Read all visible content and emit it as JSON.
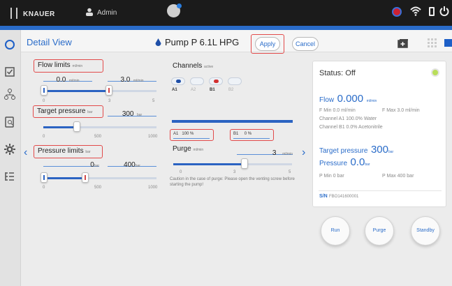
{
  "top": {
    "brand": "KNAUER",
    "user": "Admin"
  },
  "header": {
    "title": "Detail View",
    "pump": "Pump P 6.1L HPG",
    "apply": "Apply",
    "cancel": "Cancel"
  },
  "flow_limits": {
    "label": "Flow limits",
    "unit": "ml/min",
    "min": "0.0",
    "max": "3.0",
    "min_unit": "ml/min",
    "max_unit": "ml/min",
    "scale": [
      "0",
      "3",
      "5"
    ]
  },
  "target_pressure": {
    "label": "Target pressure",
    "unit": "bar",
    "value": "300",
    "value_unit": "bar",
    "scale": [
      "0",
      "500",
      "1000"
    ]
  },
  "pressure_limits": {
    "label": "Pressure limits",
    "unit": "bar",
    "min": "0",
    "max": "400",
    "min_unit": "bar",
    "max_unit": "bar",
    "scale": [
      "0",
      "500",
      "1000"
    ]
  },
  "channels": {
    "label": "Channels",
    "sub": "active",
    "items": [
      {
        "name": "A1",
        "active": true,
        "color": "#1f4fa8"
      },
      {
        "name": "A2",
        "active": false,
        "color": ""
      },
      {
        "name": "B1",
        "active": true,
        "color": "#d23030"
      },
      {
        "name": "B2",
        "active": false,
        "color": ""
      }
    ],
    "a1_label": "A1",
    "a1_value": "100",
    "a1_unit": "%",
    "b1_label": "B1",
    "b1_value": "0",
    "b1_unit": "%"
  },
  "purge": {
    "label": "Purge",
    "unit": "ml/min",
    "value": "3",
    "value_unit": "ml/min",
    "scale": [
      "0",
      "3",
      "5"
    ],
    "caution": "Caution in the case of purge: Please open the venting screw before starting the pump!"
  },
  "status": {
    "title": "Status: Off",
    "flow_label": "Flow",
    "flow_value": "0.000",
    "flow_unit": "ml/min",
    "fmin": "F Min  0.0 ml/min",
    "fmax": "F Max  3.0 ml/min",
    "channel_a1": "Channel A1   100.0%   Water",
    "channel_b1": "Channel B1   0.0%   Acetonitrile",
    "tp_label": "Target pressure",
    "tp_value": "300",
    "tp_unit": "bar",
    "p_label": "Pressure",
    "p_value": "0.0",
    "p_unit": "bar",
    "pmin": "P Min  0 bar",
    "pmax": "P Max  400 bar",
    "sn_label": "S/N",
    "sn_value": "FBO141600001"
  },
  "actions": {
    "run": "Run",
    "purge": "Purge",
    "standby": "Standby"
  },
  "colors": {
    "accent": "#2a6cc9",
    "highlight": "#e24a4a",
    "status_led": "#b9de5a"
  },
  "levels": {
    "flow_max_fraction": 0.6,
    "target_pressure_fraction": 0.3,
    "pressure_max_fraction": 0.4,
    "purge_fraction": 0.6,
    "a1_percent": 100
  }
}
